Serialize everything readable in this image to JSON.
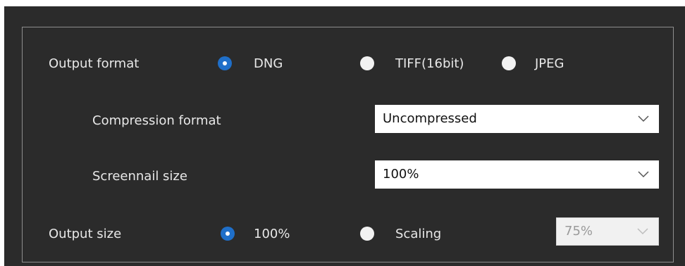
{
  "output_format": {
    "label": "Output format",
    "options": [
      {
        "label": "DNG",
        "selected": true
      },
      {
        "label": "TIFF(16bit)",
        "selected": false
      },
      {
        "label": "JPEG",
        "selected": false
      }
    ]
  },
  "compression": {
    "label": "Compression format",
    "value": "Uncompressed"
  },
  "screennail": {
    "label": "Screennail size",
    "value": "100%"
  },
  "output_size": {
    "label": "Output size",
    "options": [
      {
        "label": "100%",
        "selected": true
      },
      {
        "label": "Scaling",
        "selected": false
      }
    ],
    "scaling_value": "75%",
    "scaling_enabled": false
  },
  "colors": {
    "panel_bg": "#2b2b2b",
    "border": "#8e8e8e",
    "accent": "#1f6fc9",
    "text": "#e8e8e8"
  },
  "icons": [
    "radio-selected-icon",
    "radio-unselected-icon",
    "chevron-down-icon"
  ]
}
